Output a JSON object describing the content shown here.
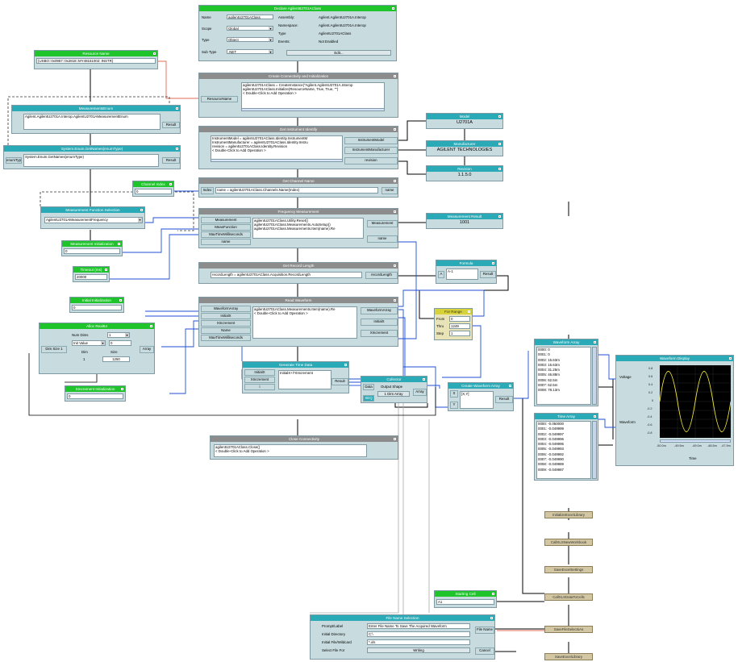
{
  "declare": {
    "title": "Declare Agilent62701AClass",
    "name_label": "Name",
    "name_value": "agilentU2701AClass",
    "scope_label": "Scope",
    "scope_value": "Global",
    "type_label": "Type",
    "type_value": "Object",
    "subtype_label": "Sub Type",
    ".net": "",
    "subtype_value": ".NET",
    "assembly_label": "Assembly:",
    "assembly_value": "Agilent.AgilentU2701A.Interop",
    "namespace_label": "Namespace:",
    "namespace_value": "Agilent.AgilentU2701A.Interop",
    "type2_label": "Type",
    "type2_value": "AgilentU2701AClass",
    "events_label": "Events:",
    "events_value": "Not Enabled",
    "edit_label": "Edit..."
  },
  "resource": {
    "title": "Resource Name",
    "value": "{USBO::0x0957::0x2818::MY48151002::INSTR}"
  },
  "create": {
    "title": "Create Connectivity and Initialization",
    "pin": "ResourceName",
    "code": "agilentU2701AClass = CreateInstance(\"Agilent.AgilentU2701A.Interop\nagilentU2701AClass.Initialize(ResourceName, True, True, \"\")\n< Double-Click to Add Operation >"
  },
  "mmenum": {
    "title": "MeasurementsEnum",
    "value": "Agilent.AgilentU2701A.Interop.AgilentU2701AMeasurementEnum",
    "out": "Result"
  },
  "sysenum": {
    "title": "System.Enum.GetNames(enumType)",
    "in": "enumType",
    "value": "System.Enum.GetNames(enumType)",
    "out": "Result"
  },
  "identity": {
    "title": "Get Instrument Identify",
    "code": "InstrumentModel = agilentU2701AClass.Identity.InstrumentM\nInstrumentManufacturer = agilentU2701AClass.Identity.Instru\nrevision = agilentU2701AClass.Identity.Revision\n< Double-Click to Add Operation >",
    "out1": "InstrumentModel",
    "out2": "InstrumentManufacturer",
    "out3": "revision"
  },
  "model": {
    "title": "Model",
    "value": "U2701A"
  },
  "manufacturer": {
    "title": "Manufacturer",
    "value": "AGILENT TECHNOLOGIES"
  },
  "revision": {
    "title": "Revision",
    "value": "1.1.5.0"
  },
  "chindex": {
    "title": "Channel Index",
    "value": "0"
  },
  "chname": {
    "title": "Get Channel Name",
    "in": "Index",
    "code": "name = agilentU2701AClass.Channels.Name(Index)",
    "out": "name"
  },
  "mfsel": {
    "title": "Measurement Function Selection",
    "value": "AgilentU2701AMeasurementFrequency"
  },
  "freq": {
    "title": "Frequency Measurement",
    "in1": "Measurement",
    "in2": "MeasFunction",
    "in3": "MaxTimeMilliseconds",
    "in4": "name",
    "code": "agilentU2701AClass.Utility.Reset()\nagilentU2701AClass.Measurements.AutoSetup()\nagilentU2701AClass.Measurements.Item(name).Re",
    "out1": "Measurement",
    "out2": "name"
  },
  "mresult": {
    "title": "Measurement Result",
    "value": "1001"
  },
  "minit": {
    "title": "Measurement Initialization",
    "value": "0"
  },
  "timeout": {
    "title": "Timeout (ms)",
    "value": "20000"
  },
  "reclen": {
    "title": "Get Record Length",
    "code": "recordLength = agilentU2701AClass.Acquisition.RecordLength",
    "out": "recordLength"
  },
  "formula": {
    "title": "Formula",
    "in": "A",
    "value": "A-1",
    "out": "Result"
  },
  "initxinit": {
    "title": "Initial Initialization",
    "value": "0"
  },
  "readwf": {
    "title": "Read Waveform",
    "in1": "WaveformArray",
    "in2": "InitialX",
    "in3": "XIncrement",
    "in4": "Name",
    "in5": "MaxTimeMilliseconds",
    "code": "agilentU2701AClass.Measurements.Item(name).Re\n< Double-Click to Add Operation >",
    "out1": "WaveformArray",
    "out2": "InitialX",
    "out3": "XIncrement"
  },
  "forrange": {
    "title": "For Range",
    "from_label": "From",
    "from_value": "0",
    "thru_label": "Thru",
    "thru_value": "1249",
    "step_label": "Step",
    "step_value": "1"
  },
  "alloc": {
    "title": "Alloc Real64",
    "numdims_label": "Num Dims",
    "numdims_value": "1",
    "initval_label": "Init Value",
    "initval_value": "0",
    "dim_label": "Dim",
    "size_label": "Size",
    "dim_value": "1",
    "size_value": "1250",
    "in": "Dim Size 1",
    "out": "Array"
  },
  "gentime": {
    "title": "Generate Time Data",
    "in1": "InitialX",
    "in2": "XIncrement",
    "in3": "i",
    "code": "InitialX+i*XIncrement",
    "out": "Result"
  },
  "collector": {
    "title": "Collector",
    "in1": "Data",
    "in2": "XEQ",
    "out_label": "Output Shape",
    "out_value": "1 Dim Array",
    "out": "Array"
  },
  "createwf": {
    "title": "Create Waveform Array",
    "in1": "X",
    "in2": "Y",
    "value": "[X,Y]",
    "out": "Result"
  },
  "xinc": {
    "title": "XIncrement Initialization",
    "value": "0"
  },
  "wfarray": {
    "title": "Waveform Array",
    "rows": [
      "0000: 0",
      "0001: 0",
      "0002: 15.63m",
      "0003: 15.63m",
      "0004: 31.25m",
      "0005: 46.88m",
      "0006: 62.5m",
      "0007: 62.5m",
      "0008: 78.13m"
    ]
  },
  "timearray": {
    "title": "Time Array",
    "rows": [
      "0000: -0.050000",
      "0001: -0.049999",
      "0002: -0.049997",
      "0003: -0.049996",
      "0004: -0.049995",
      "0005: -0.049993",
      "0006: -0.049992",
      "0007: -0.049990",
      "0008: -0.049989",
      "0009: -0.049987"
    ]
  },
  "display": {
    "title": "Waveform Display",
    "in1": "Voltage",
    "in2": "Waveform",
    "xlabel": "Time",
    "yticks": [
      "0.8",
      "0.6",
      "0.4",
      "0.2",
      "0",
      "-0.2",
      "-0.4",
      "-0.6",
      "-0.8"
    ],
    "xticks": [
      "-50.0m",
      "-49.5m",
      "-49.0m",
      "-48.5m",
      "-47.9m"
    ]
  },
  "close": {
    "title": "Close Connectivity",
    "code": "agilentU2701AClass.Close()\n< Double-Click to Add Operation >"
  },
  "startingcell": {
    "title": "Starting Cell",
    "value": "A1"
  },
  "filesel": {
    "title": "File Name Selection",
    "prompt_label": "Prompt/Label",
    "prompt_value": "Enter File Name To Save The Acquired Waveform",
    "initdir_label": "Initial Directory",
    "initdir_value": "C:\\",
    "initfile_label": "Initial File/Wildcard",
    "initfile_value": "*.xls",
    "select_label": "Select File For",
    "select_value": "Writing",
    "out1": "File Name",
    "out2": "Cancel"
  },
  "sequence": [
    "InitializeExcelLibrary",
    "CallXLSNewWorkbook",
    "SaveExcelSettings",
    "CallXLSDataToCells",
    "SaveFileSelectsAs",
    "SaveExcelLibrary"
  ]
}
